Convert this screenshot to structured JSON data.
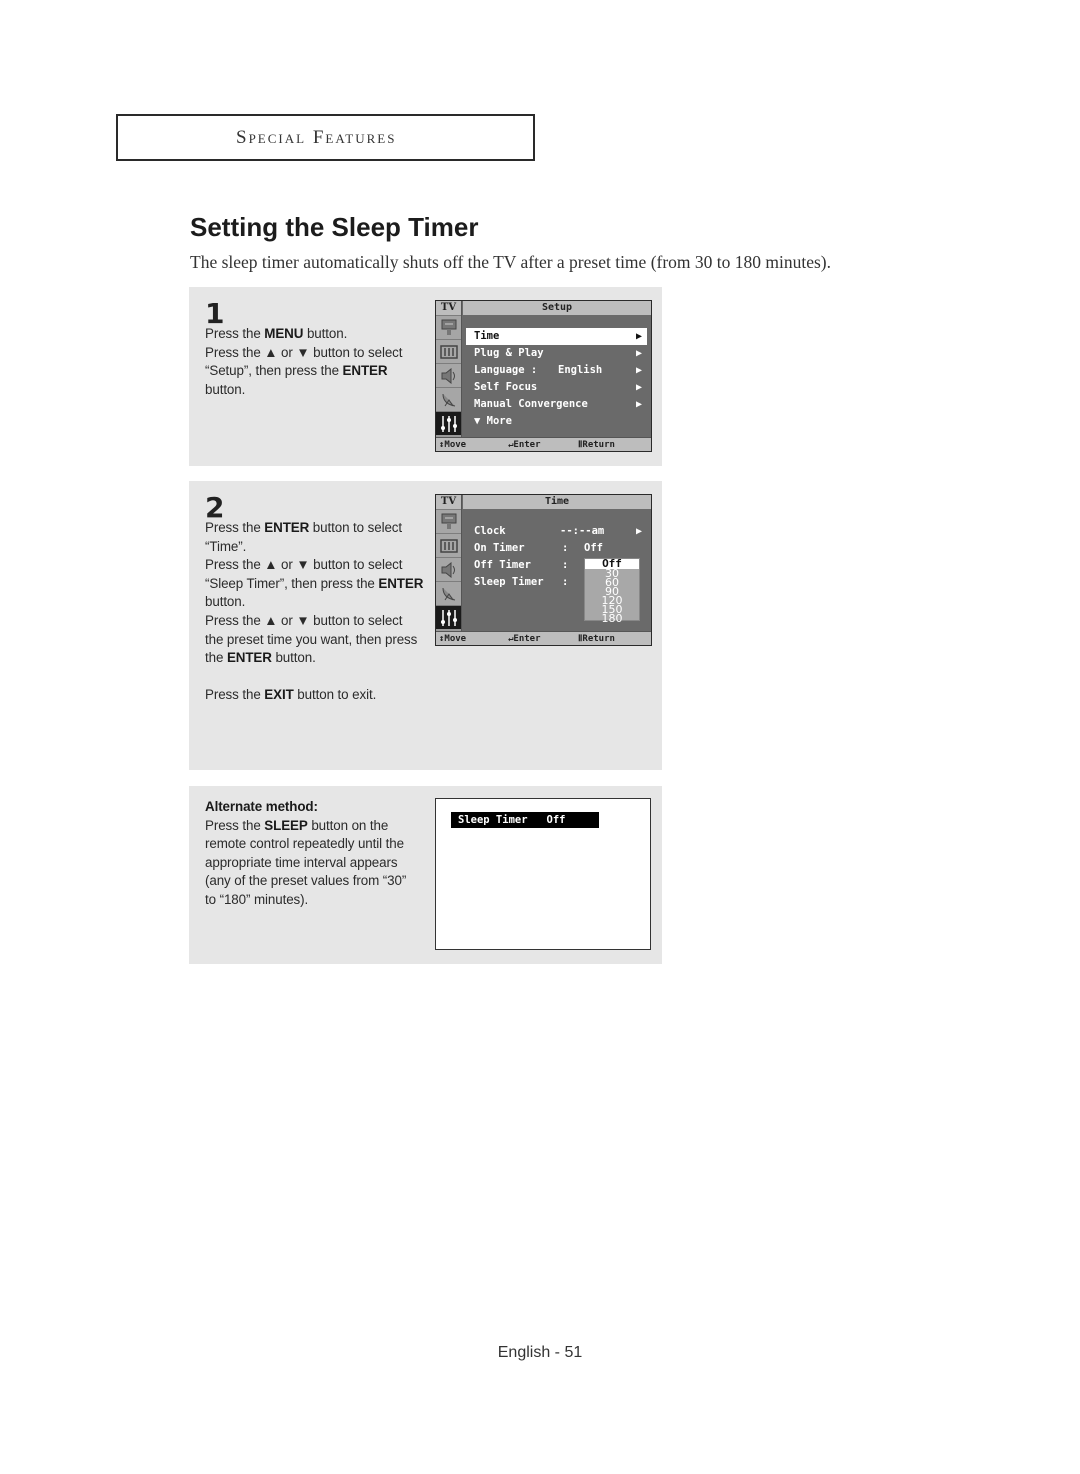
{
  "section": {
    "title": "Special Features"
  },
  "page": {
    "title": "Setting the Sleep Timer",
    "intro": "The sleep timer automatically shuts off the TV after a preset time (from 30 to 180 minutes)."
  },
  "step1": {
    "number": "1",
    "lines": [
      [
        "Press the ",
        "MENU",
        " button."
      ],
      [
        "Press the ▲ or ▼ button to select",
        "",
        ""
      ],
      [
        "“Setup”, then press the ",
        "ENTER",
        ""
      ],
      [
        "button.",
        "",
        ""
      ]
    ],
    "osd": {
      "tv_label": "TV",
      "header": "Setup",
      "items": [
        {
          "label": "Time",
          "value": "",
          "arrow": "▶",
          "selected": true
        },
        {
          "label": "Plug & Play",
          "value": "",
          "arrow": "▶",
          "selected": false
        },
        {
          "label": "Language  :",
          "value": "English",
          "arrow": "▶",
          "selected": false
        },
        {
          "label": "Self Focus",
          "value": "",
          "arrow": "▶",
          "selected": false
        },
        {
          "label": "Manual Convergence",
          "value": "",
          "arrow": "▶",
          "selected": false
        },
        {
          "label": "▼  More",
          "value": "",
          "arrow": "",
          "selected": false
        }
      ],
      "footer": {
        "move": "↕Move",
        "enter": "↵Enter",
        "return": "ⅡReturn"
      }
    }
  },
  "step2": {
    "number": "2",
    "lines": [
      [
        "Press the ",
        "ENTER",
        " button to select"
      ],
      [
        "“Time”.",
        "",
        ""
      ],
      [
        "Press the ▲ or ▼ button to select",
        "",
        ""
      ],
      [
        "“Sleep Timer”, then press the ",
        "ENTER",
        ""
      ],
      [
        "button.",
        "",
        ""
      ],
      [
        "Press the ▲ or ▼ button to select",
        "",
        ""
      ],
      [
        "the preset time you want, then press",
        "",
        ""
      ],
      [
        "the ",
        "ENTER",
        " button."
      ],
      [
        "",
        "",
        ""
      ],
      [
        "Press the ",
        "EXIT",
        " button to exit."
      ]
    ],
    "osd": {
      "tv_label": "TV",
      "header": "Time",
      "items": [
        {
          "label": "Clock",
          "colon": "",
          "value": "--:--am",
          "arrow": "▶"
        },
        {
          "label": "On Timer",
          "colon": ":",
          "value": "Off",
          "arrow": ""
        },
        {
          "label": "Off Timer",
          "colon": ":",
          "value": "",
          "arrow": ""
        },
        {
          "label": "Sleep Timer",
          "colon": ":",
          "value": "",
          "arrow": ""
        }
      ],
      "dropdown_options": [
        "Off",
        "30",
        "60",
        "90",
        "120",
        "150",
        "180"
      ],
      "dropdown_selected": "Off",
      "footer": {
        "move": "↕Move",
        "enter": "↵Enter",
        "return": "ⅡReturn"
      }
    }
  },
  "alternate": {
    "heading": "Alternate method:",
    "lines": [
      [
        "Press the ",
        "SLEEP",
        " button on the"
      ],
      [
        "remote control repeatedly until the",
        "",
        ""
      ],
      [
        "appropriate time interval appears",
        "",
        ""
      ],
      [
        "(any of the preset values from “30”",
        "",
        ""
      ],
      [
        "to “180” minutes).",
        "",
        ""
      ]
    ],
    "screen_bar": "Sleep Timer   Off"
  },
  "footer": {
    "page_label": "English - 51"
  }
}
